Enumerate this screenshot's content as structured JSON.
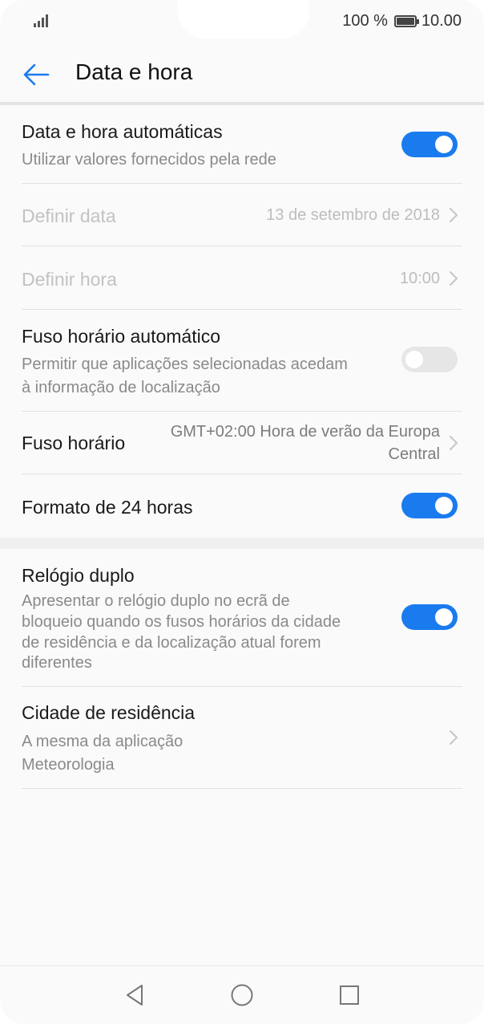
{
  "status_bar": {
    "battery_percent": "100 %",
    "time": "10.00",
    "icons": [
      "signal-icon",
      "battery-icon"
    ]
  },
  "toolbar": {
    "back_icon": "arrow-left-icon",
    "title": "Data e hora"
  },
  "settings": {
    "auto_datetime": {
      "title": "Data e hora automáticas",
      "subtitle": "Utilizar valores fornecidos pela rede",
      "toggle_on": true
    },
    "set_date": {
      "title": "Definir data",
      "value": "13 de setembro de 2018",
      "enabled": false
    },
    "set_time": {
      "title": "Definir hora",
      "value": "10:00",
      "enabled": false
    },
    "auto_timezone": {
      "title": "Fuso horário automático",
      "subtitle_line1": "Permitir que aplicações selecionadas acedam",
      "subtitle_line2": "à informação de localização",
      "toggle_on": false
    },
    "timezone": {
      "title": "Fuso horário",
      "value_line1": "GMT+02:00 Hora de verão da Europa",
      "value_line2": "Central"
    },
    "format_24h": {
      "title": "Formato de 24 horas",
      "toggle_on": true
    },
    "dual_clock": {
      "title": "Relógio duplo",
      "subtitle_line1": "Apresentar o relógio duplo no ecrã de",
      "subtitle_line2": "bloqueio quando os fusos horários da cidade",
      "subtitle_line3": "de residência e da localização atual forem",
      "subtitle_line4": "diferentes",
      "toggle_on": true
    },
    "home_city": {
      "title": "Cidade de residência",
      "subtitle_line1": "A mesma da aplicação",
      "subtitle_line2": "Meteorologia"
    }
  },
  "nav_bar": {
    "back_icon": "triangle-back-icon",
    "home_icon": "circle-home-icon",
    "recents_icon": "square-recents-icon"
  },
  "colors": {
    "accent": "#1a7bee",
    "toggle_off": "#e6e6e6",
    "disabled_text": "#c2c2c2"
  }
}
